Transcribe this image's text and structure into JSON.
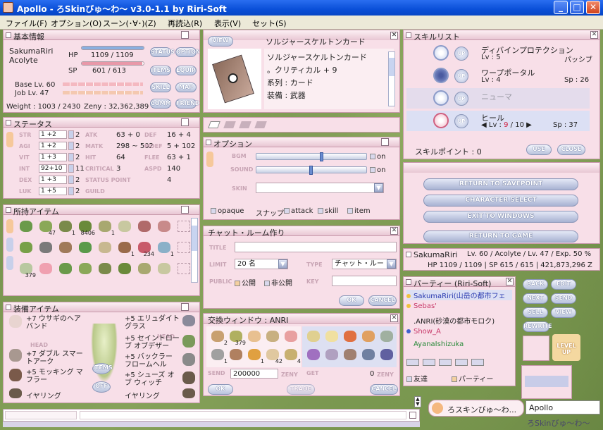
{
  "window": {
    "title": "Apollo - ろSkinびゅ〜わ〜 v3.0-1.1 by Riri-Soft"
  },
  "menu": [
    "ファイル(F)",
    "オプション(O)",
    "スーン(･∀･)(Z)",
    "再読込(R)",
    "表示(V)",
    "セット(S)"
  ],
  "basic": {
    "title": "基本情報",
    "name": "SakumaRiri",
    "job": "Acolyte",
    "hp_label": "HP",
    "hp": "1109 / 1109",
    "hp_fraction": 1.0,
    "sp_label": "SP",
    "sp": "601 / 613",
    "sp_fraction": 0.98,
    "base_lv": "Base Lv. 60",
    "job_lv": "Job Lv. 47",
    "weight": "Weight : 1003 / 2430",
    "zeny": "Zeny : 32,362,389",
    "buttons": [
      "STATUS",
      "OPTION",
      "ITEMS",
      "EQUIP",
      "SKILL",
      "MAP",
      "COMM",
      "FRIEND"
    ]
  },
  "status": {
    "title": "ステータス",
    "rows": [
      {
        "stat": "STR",
        "val": "1 +2",
        "pts": "2",
        "k1": "ATK",
        "v1": "63 + 0",
        "k2": "DEF",
        "v2": "16 + 4"
      },
      {
        "stat": "AGI",
        "val": "1 +2",
        "pts": "2",
        "k1": "MATK",
        "v1": "298 ~ 502",
        "k2": "MDEF",
        "v2": "5 + 102"
      },
      {
        "stat": "VIT",
        "val": "1 +3",
        "pts": "2",
        "k1": "HIT",
        "v1": "64",
        "k2": "FLEE",
        "v2": "63 + 1"
      },
      {
        "stat": "INT",
        "val": "92+10",
        "pts": "11",
        "k1": "CRITICAL",
        "v1": "3",
        "k2": "ASPD",
        "v2": "140"
      },
      {
        "stat": "DEX",
        "val": "1 +3",
        "pts": "2",
        "k1": "STATUS POINT",
        "v1": "",
        "k2": "",
        "v2": "4"
      },
      {
        "stat": "LUK",
        "val": "1 +5",
        "pts": "2",
        "k1": "GUILD",
        "v1": "",
        "k2": "",
        "v2": ""
      }
    ]
  },
  "items": {
    "title": "所持アイテム",
    "quantities": [
      "",
      "47",
      "1",
      "8406",
      "1",
      "",
      "",
      "",
      "",
      "",
      "",
      "",
      "",
      "",
      "1",
      "234",
      "1",
      "",
      "379",
      "",
      "",
      "",
      "",
      "",
      "",
      "",
      ""
    ]
  },
  "equip": {
    "title": "装備アイテム",
    "left": [
      "+7 ウサギのヘアバンド",
      "HEAD",
      "+7 ダブル スマートアーク",
      "+5 モッキング マフラー",
      "イヤリング"
    ],
    "right": [
      "+5 エリュダイト グラス",
      "+5 セイントローブ オブデザー",
      "+5 バックラー フロームヘル",
      "+5 シューズ オブ ウィッチ",
      "イヤリング"
    ],
    "tag_head": "HEAD",
    "btn_items": "ITEMS",
    "btn_off": "OFF"
  },
  "card": {
    "view_btn": "VIEW",
    "title": "ソルジャースケルトンカード",
    "name": "ソルジャースケルトンカード",
    "line1": "。クリティカル + 9",
    "line2": "系列 : カード",
    "line3": "装備 : 武器"
  },
  "options": {
    "title": "オプション",
    "bgm": "BGM",
    "sound": "SOUND",
    "skin": "SKIN",
    "on1": "on",
    "on2": "on",
    "bgm_level": 0.6,
    "sound_level": 0.5,
    "chk_opaque": "opaque",
    "snap": "スナップ",
    "chk_attack": "attack",
    "chk_skill": "skill",
    "chk_item": "item"
  },
  "chatroom": {
    "title": "チャット・ルーム作り",
    "title_lbl": "TITLE",
    "limit_lbl": "LIMIT",
    "limit": "20 名",
    "type_lbl": "TYPE",
    "type": "チャット・ルー",
    "public_lbl": "PUBLIC",
    "public": "公開",
    "private": "非公開",
    "key_lbl": "KEY",
    "ok": "OK",
    "cancel": "CANCEL"
  },
  "trade": {
    "title": "交換ウィンドウ : ANRI",
    "send_lbl": "SEND",
    "send_zeny": "200000",
    "zeny": "ZENY",
    "get_lbl": "GET",
    "get_zeny": "0",
    "ok": "OK",
    "trade": "TRADE",
    "cancel": "CANCEL",
    "qty": [
      "2",
      "379",
      "",
      "",
      "",
      "1",
      "",
      "1",
      "42",
      "4"
    ]
  },
  "skills": {
    "title": "スキルリスト",
    "list": [
      {
        "name": "ディバインプロテクション",
        "lv": "Lv : 5",
        "extra": "パッシブ"
      },
      {
        "name": "ワープポータル",
        "lv": "Lv : 4",
        "extra": "Sp : 26"
      },
      {
        "name": "ニューマ",
        "lv": "",
        "extra": ""
      },
      {
        "name": "ヒール",
        "lv": "Lv :",
        "cur": "9",
        "max": "/ 10",
        "extra": "Sp : 37"
      }
    ],
    "points": "スキルポイント : 0",
    "use": "USE",
    "close": "CLOSE"
  },
  "menu_panel": {
    "savepoint": "RETURN TO SAVEPOINT",
    "charselect": "CHARACTER SELECT",
    "exit": "EXIT TO WINDOWS",
    "game": "RETURN TO GAME"
  },
  "charinfo": {
    "name": "SakumaRiri",
    "lv": "Lv. 60 / Acolyte / Lv. 47 / Exp. 50 %",
    "line2": "HP 1109 / 1109 | SP 615 / 615 | 421,873,296 Z"
  },
  "party": {
    "title": "パーティー (Riri-Soft)",
    "members": [
      {
        "name": "SakumaRiri(山岳の都市フェ",
        "color": "#2a3ab0",
        "dot": "#f0c040"
      },
      {
        "name": "Sebas'",
        "color": "#c83a6a",
        "dot": "#f0c040"
      },
      {
        "name": ".ANRI(砂漠の都市モロク)",
        "color": "#222",
        "dot": ""
      },
      {
        "name": "Show_A",
        "color": "#c83a6a",
        "dot": "#4060d0"
      },
      {
        "name": "AyanaIshizuka",
        "color": "#2a8a3a",
        "dot": ""
      }
    ],
    "buttons": [
      "BACK",
      "EDIT",
      "NEXT",
      "SEND",
      "SELL",
      "VIEW",
      "REWRITE"
    ],
    "friend": "友達",
    "party": "パーティー",
    "levelup": "LEVEL UP"
  },
  "chat": {
    "bubble": "ろスキンびゅ〜わ...",
    "apollo": "Apollo",
    "skin": "ろSkinびゅ〜わ〜"
  }
}
